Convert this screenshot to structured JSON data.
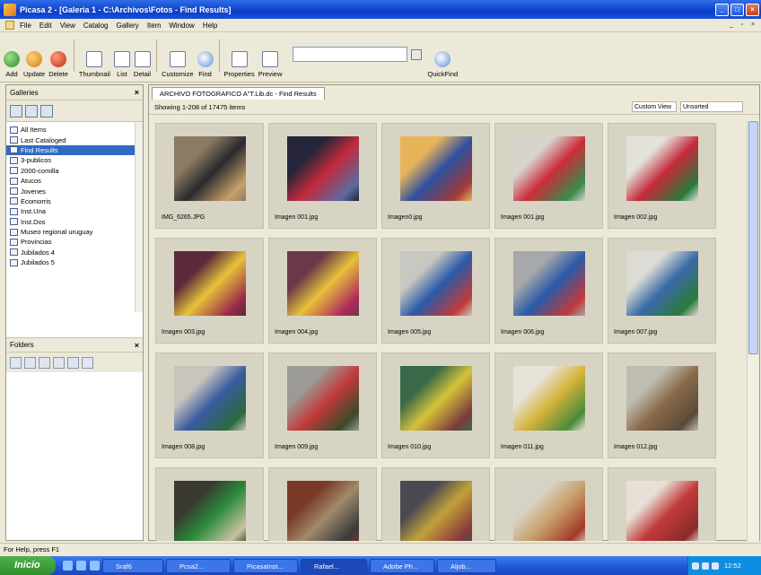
{
  "window": {
    "title": "Picasa 2 - [Galeria 1 - C:\\Archivos\\Fotos - Find Results]"
  },
  "menu": [
    "File",
    "Edit",
    "View",
    "Catalog",
    "Gallery",
    "Item",
    "Window",
    "Help"
  ],
  "toolbar": {
    "buttons": [
      "Add",
      "Update",
      "Delete",
      "Thumbnail",
      "List",
      "Detail",
      "Customize",
      "Find",
      "Properties",
      "Preview"
    ],
    "search_value": "",
    "quickfind": "QuickFind"
  },
  "galleries": {
    "title": "Galleries",
    "items": [
      "All Items",
      "Last Cataloged",
      "Find Results",
      "3-publicos",
      "2000-comilla",
      "Atucos",
      "Jovenes",
      "Ecomorris",
      "Inst.Una",
      "Inst.Dos",
      "Museo regional uruguay",
      "Provincias",
      "Jubilados 4",
      "Jubilados 5"
    ],
    "selected_index": 2
  },
  "folders": {
    "title": "Folders"
  },
  "content": {
    "tab_label": "ARCHIVO FOTOGRAFICO A\"T.Lib.dc - Find Results",
    "showing": "Showing 1-208 of 17475 items",
    "view_mode": "Custom View",
    "sort": "Unsorted",
    "thumbnails": [
      {
        "caption": "IMG_6265.JPG",
        "colors": [
          "#8c7b64",
          "#2b2a2d",
          "#c7a06a"
        ]
      },
      {
        "caption": "Imagen 001.jpg",
        "colors": [
          "#26253a",
          "#c02a3a",
          "#5c6aa0"
        ]
      },
      {
        "caption": "Imagen0.jpg",
        "colors": [
          "#e7b45a",
          "#2f4f9e",
          "#a23a3a"
        ]
      },
      {
        "caption": "Imagen 001.jpg",
        "colors": [
          "#d6d4cc",
          "#cc2c3a",
          "#3a8a4a"
        ]
      },
      {
        "caption": "Imagen 002.jpg",
        "colors": [
          "#e3e2da",
          "#c42a3a",
          "#2a7a3a"
        ]
      },
      {
        "caption": "Imagen 003.jpg",
        "colors": [
          "#5a2a3a",
          "#e6c23a",
          "#9a2a4a"
        ]
      },
      {
        "caption": "Imagen 004.jpg",
        "colors": [
          "#6a3a4a",
          "#e6c23a",
          "#b02a5a"
        ]
      },
      {
        "caption": "Imagen 005.jpg",
        "colors": [
          "#c8c8c2",
          "#2a5aa8",
          "#c23a3a"
        ]
      },
      {
        "caption": "Imagen 006.jpg",
        "colors": [
          "#a6a8aa",
          "#2a5aa8",
          "#c23a3a"
        ]
      },
      {
        "caption": "Imagen 007.jpg",
        "colors": [
          "#dcdcd4",
          "#3a6aa8",
          "#2a7a3a"
        ]
      },
      {
        "caption": "Imagen 008.jpg",
        "colors": [
          "#c8c6bc",
          "#3a5aa0",
          "#2a6a3a"
        ]
      },
      {
        "caption": "Imagen 009.jpg",
        "colors": [
          "#9c9a94",
          "#c23a3a",
          "#3a4a2a"
        ]
      },
      {
        "caption": "Imagen 010.jpg",
        "colors": [
          "#3a6a4a",
          "#d6c23a",
          "#7a3a3a"
        ]
      },
      {
        "caption": "Imagen 011.jpg",
        "colors": [
          "#e6e2d6",
          "#d6b23a",
          "#4a8a3a"
        ]
      },
      {
        "caption": "Imagen 012.jpg",
        "colors": [
          "#c0bcb2",
          "#8a6a4a",
          "#5a4a3a"
        ]
      },
      {
        "caption": "",
        "colors": [
          "#3a3a32",
          "#2a8a3a",
          "#c8c2a0"
        ]
      },
      {
        "caption": "",
        "colors": [
          "#7a3a2a",
          "#a08a6a",
          "#3a3a3a"
        ]
      },
      {
        "caption": "",
        "colors": [
          "#4a4a52",
          "#c2a23a",
          "#8a3a3a"
        ]
      },
      {
        "caption": "",
        "colors": [
          "#d6d2c6",
          "#c8a06a",
          "#a23a2a"
        ]
      },
      {
        "caption": "",
        "colors": [
          "#e6e0d6",
          "#c23a3a",
          "#8a2a2a"
        ]
      }
    ]
  },
  "statusbar": {
    "text": "For Help, press F1"
  },
  "taskbar": {
    "start": "Inicio",
    "tasks": [
      "Sraf6",
      "Pcsa2...",
      "PicasaInst...",
      "Rafael...",
      "Adobe Ph...",
      "Aljob..."
    ],
    "active_task_index": 3,
    "clock": "12:52"
  }
}
